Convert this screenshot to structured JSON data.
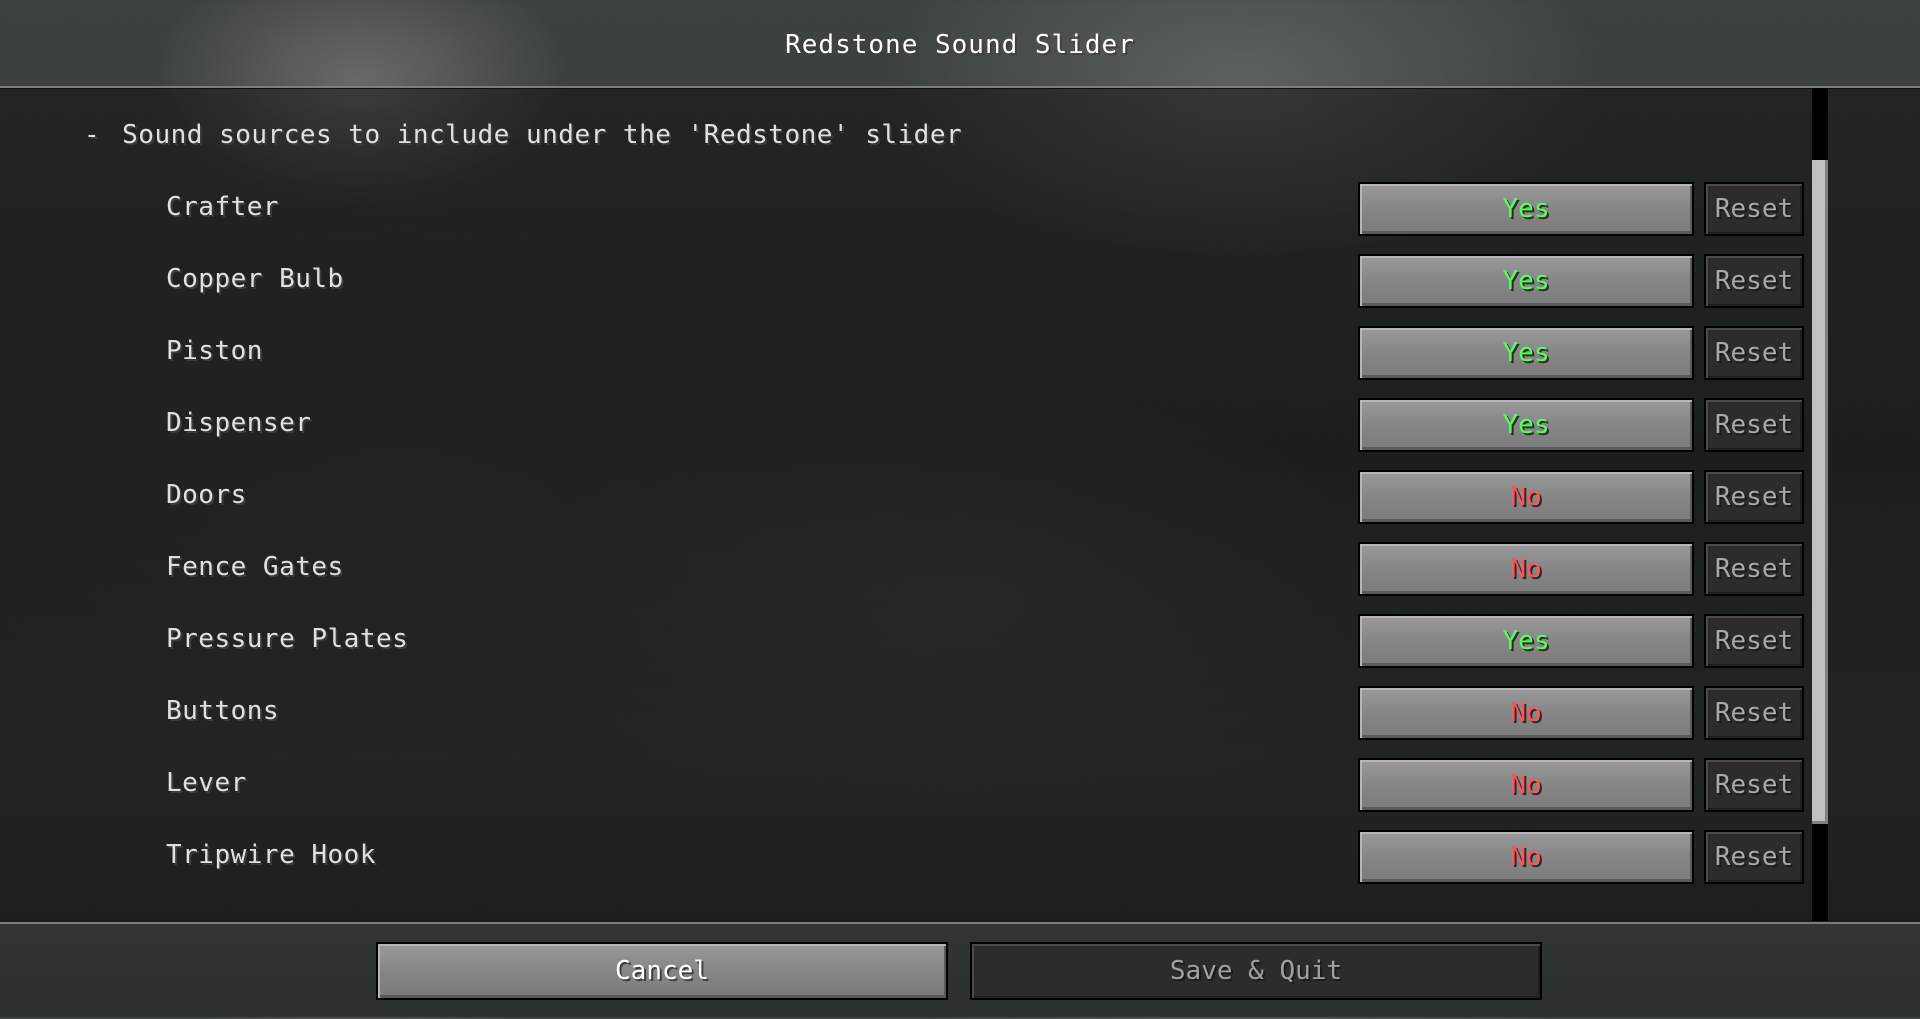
{
  "header": {
    "title": "Redstone Sound Slider"
  },
  "section": {
    "collapse_symbol": "-",
    "label": "Sound sources to include under the 'Redstone' slider"
  },
  "options": [
    {
      "label": "Crafter",
      "value": "Yes",
      "reset": "Reset"
    },
    {
      "label": "Copper Bulb",
      "value": "Yes",
      "reset": "Reset"
    },
    {
      "label": "Piston",
      "value": "Yes",
      "reset": "Reset"
    },
    {
      "label": "Dispenser",
      "value": "Yes",
      "reset": "Reset"
    },
    {
      "label": "Doors",
      "value": "No",
      "reset": "Reset"
    },
    {
      "label": "Fence Gates",
      "value": "No",
      "reset": "Reset"
    },
    {
      "label": "Pressure Plates",
      "value": "Yes",
      "reset": "Reset"
    },
    {
      "label": "Buttons",
      "value": "No",
      "reset": "Reset"
    },
    {
      "label": "Lever",
      "value": "No",
      "reset": "Reset"
    },
    {
      "label": "Tripwire Hook",
      "value": "No",
      "reset": "Reset"
    }
  ],
  "footer": {
    "cancel_label": "Cancel",
    "save_label": "Save & Quit"
  },
  "colors": {
    "yes": "#55ff55",
    "no": "#ff5555"
  }
}
